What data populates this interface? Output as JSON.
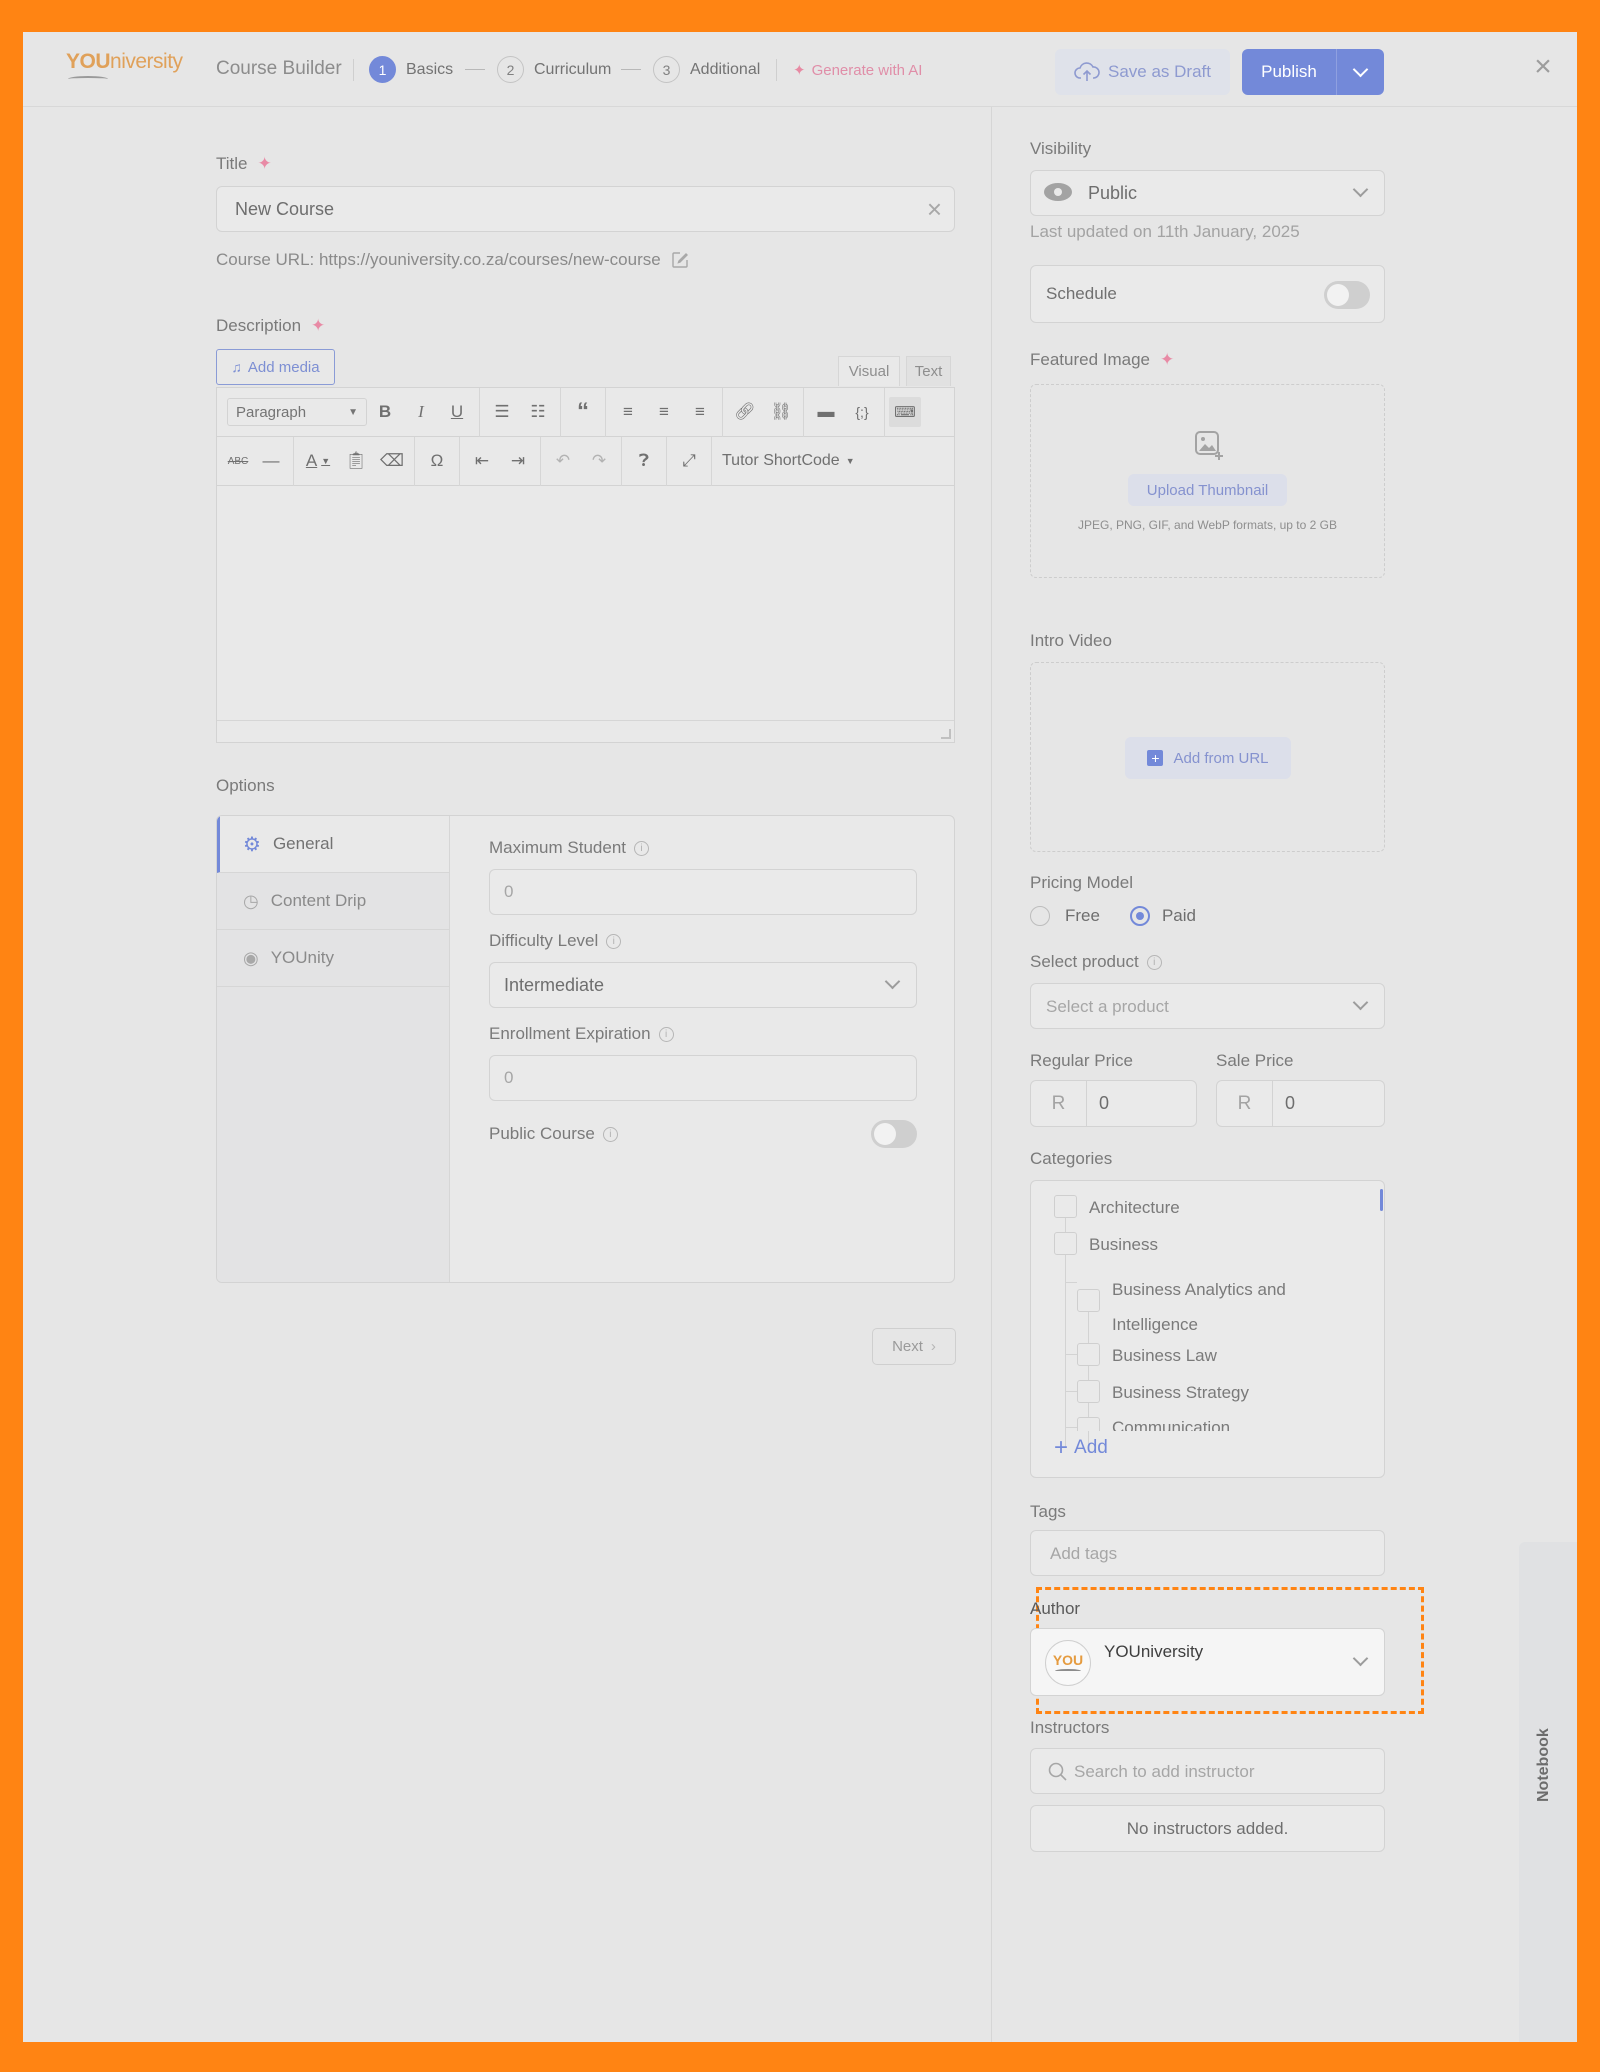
{
  "header": {
    "logo_bold": "YOU",
    "logo_rest": "niversity",
    "title": "Course Builder",
    "steps": [
      {
        "num": "1",
        "label": "Basics",
        "active": true
      },
      {
        "num": "2",
        "label": "Curriculum",
        "active": false
      },
      {
        "num": "3",
        "label": "Additional",
        "active": false
      }
    ],
    "generate_ai": "Generate with AI",
    "save_draft": "Save as Draft",
    "publish": "Publish"
  },
  "main": {
    "title_label": "Title",
    "title_value": "New Course",
    "course_url": "Course URL: https://youniversity.co.za/courses/new-course",
    "description_label": "Description",
    "add_media": "Add media",
    "editor_tabs": {
      "visual": "Visual",
      "text": "Text"
    },
    "paragraph_select": "Paragraph",
    "tutor_shortcode": "Tutor ShortCode",
    "options_label": "Options",
    "options_tabs": [
      {
        "label": "General",
        "icon": "gear-icon",
        "active": true
      },
      {
        "label": "Content Drip",
        "icon": "clock-icon",
        "active": false
      },
      {
        "label": "YOUnity",
        "icon": "community-icon",
        "active": false
      }
    ],
    "general": {
      "max_student_label": "Maximum Student",
      "max_student_placeholder": "0",
      "difficulty_label": "Difficulty Level",
      "difficulty_value": "Intermediate",
      "enrollment_label": "Enrollment Expiration",
      "enrollment_placeholder": "0",
      "public_course_label": "Public Course",
      "public_course_on": false
    },
    "next": "Next"
  },
  "sidebar": {
    "visibility_label": "Visibility",
    "visibility_value": "Public",
    "last_updated": "Last updated on 11th January, 2025",
    "schedule_label": "Schedule",
    "schedule_on": false,
    "featured_image_label": "Featured Image",
    "upload_thumbnail": "Upload Thumbnail",
    "upload_hint": "JPEG, PNG, GIF, and WebP formats, up to 2 GB",
    "intro_video_label": "Intro Video",
    "add_from_url": "Add from URL",
    "pricing_label": "Pricing Model",
    "pricing_options": [
      "Free",
      "Paid"
    ],
    "pricing_selected": "Paid",
    "select_product_label": "Select product",
    "select_product_placeholder": "Select a product",
    "regular_price_label": "Regular Price",
    "sale_price_label": "Sale Price",
    "currency": "R",
    "regular_price": "0",
    "sale_price": "0",
    "categories_label": "Categories",
    "categories": [
      {
        "label": "Architecture",
        "level": 0
      },
      {
        "label": "Business",
        "level": 0
      },
      {
        "label": "Business Analytics and Intelligence",
        "level": 1
      },
      {
        "label": "Business Law",
        "level": 1
      },
      {
        "label": "Business Strategy",
        "level": 1
      },
      {
        "label": "Communication",
        "level": 1
      }
    ],
    "add_category": "Add",
    "tags_label": "Tags",
    "tags_placeholder": "Add tags",
    "author_label": "Author",
    "author_name": "YOUniversity",
    "author_avatar_text": "YOU",
    "instructors_label": "Instructors",
    "instructor_search_placeholder": "Search to add instructor",
    "no_instructors": "No instructors added.",
    "notebook": "Notebook"
  },
  "colors": {
    "frame": "#ff8413",
    "accent": "#7389d9",
    "logo": "#e0a15a"
  }
}
